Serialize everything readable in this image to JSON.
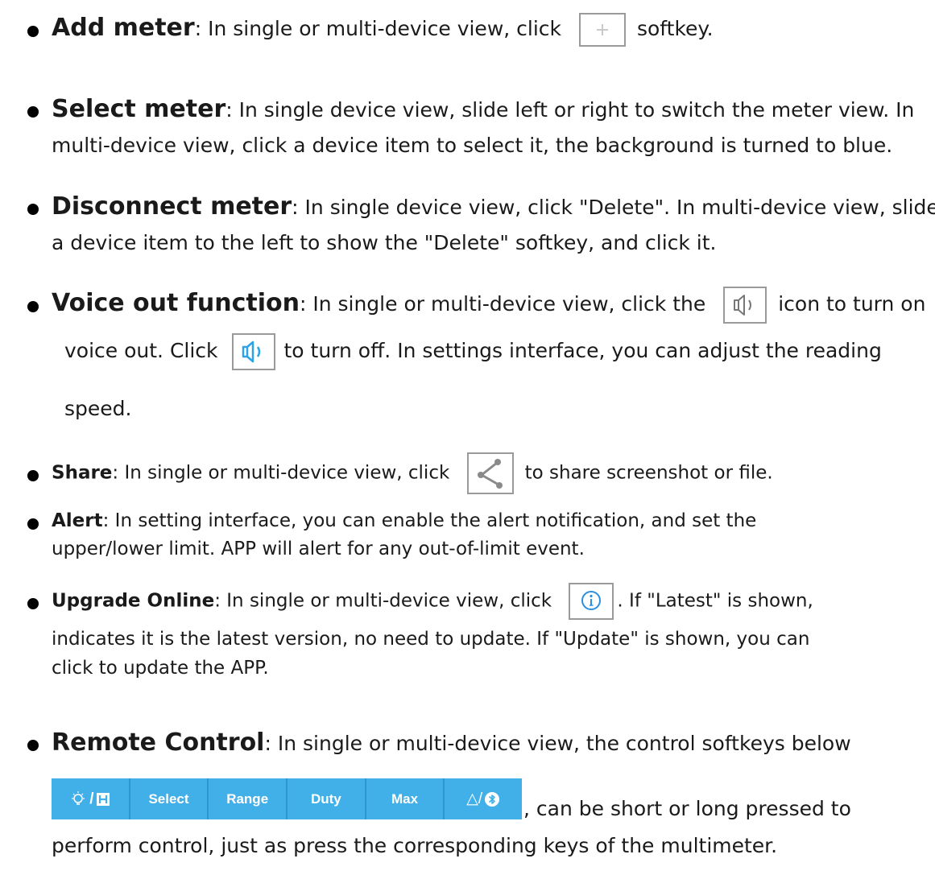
{
  "items": [
    {
      "title": "Add meter",
      "text_before": ": In single or multi-device view, click",
      "icon": "plus-icon",
      "text_after": "softkey."
    },
    {
      "title": "Select meter",
      "line1": ": In single device view, slide left or right to switch the meter view. In",
      "line2": "multi-device view, click a device item to select it, the background is turned to blue."
    },
    {
      "title": "Disconnect meter",
      "line1": ": In single device view, click \"Delete\". In multi-device view, slide",
      "line2": "a device item to the left to show the \"Delete\" softkey, and click it."
    },
    {
      "title": "Voice out function",
      "line1_before": ": In single or multi-device view, click the",
      "icon_off": "speaker-icon",
      "line1_after": "icon to turn on",
      "line2_before": "voice out. Click",
      "icon_on": "speaker-icon",
      "line2_after": "to turn off. In settings interface, you can adjust the reading",
      "line3": "speed."
    },
    {
      "title": "Share",
      "text_before": ": In single or multi-device view, click",
      "icon": "share-icon",
      "text_after": "to share screenshot or file."
    },
    {
      "title": "Alert",
      "line1": ": In setting interface, you can enable the alert notification, and set the",
      "line2": "upper/lower limit. APP will alert for any out-of-limit event."
    },
    {
      "title": "Upgrade Online",
      "text_before": ": In single or multi-device view, click",
      "icon": "info-icon",
      "text_after": ". If \"Latest\" is shown,",
      "line2": "indicates it is the latest version, no need to update. If \"Update\" is shown, you can",
      "line3": "click to update the APP."
    },
    {
      "title": "Remote Control",
      "line1": ": In single or multi-device view, the control softkeys below",
      "softkeys": [
        "/",
        "Select",
        "Range",
        "Duty",
        "Max",
        "△/"
      ],
      "after_softkeys": ", can be short or long pressed to",
      "line3": "perform control, just as press the corresponding keys of the multimeter."
    }
  ],
  "colors": {
    "softkey_bg": "#41b0e8",
    "softkey_text": "#ffffff",
    "speaker_active": "#2ba3e6",
    "info_icon": "#2b8fe0",
    "plus_icon": "#c9c9c9",
    "share_icon": "#8a8a8a"
  }
}
